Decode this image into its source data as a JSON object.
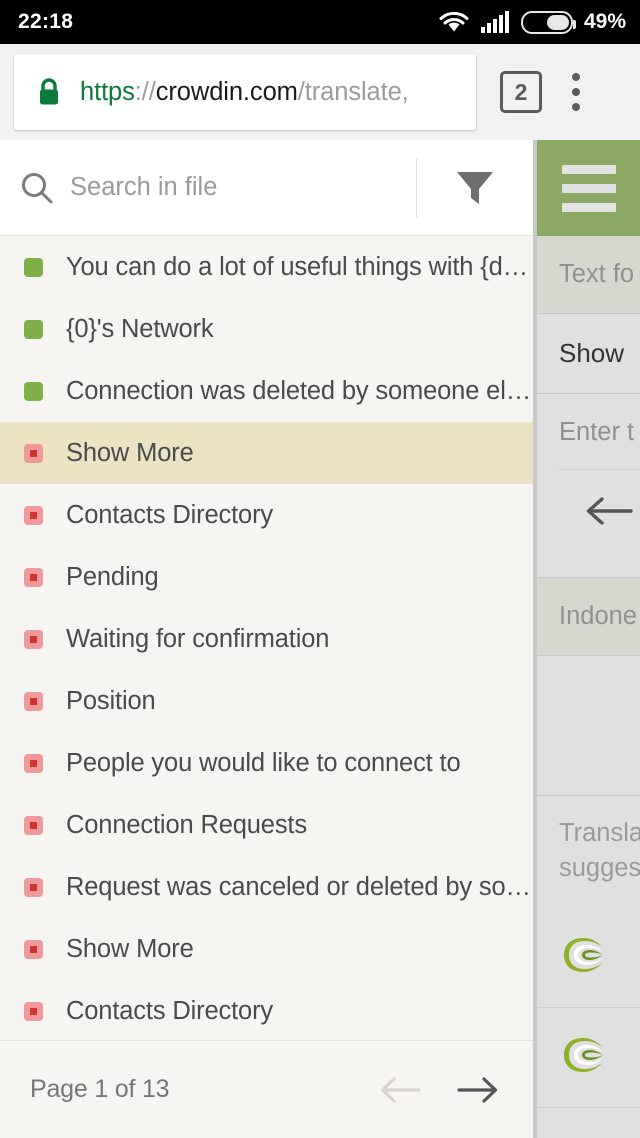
{
  "status_bar": {
    "time": "22:18",
    "battery_percent": "49%",
    "battery_level": 49,
    "icons": [
      "wifi-icon",
      "cellular-signal-icon",
      "battery-icon"
    ]
  },
  "browser": {
    "url_scheme": "https",
    "url_separator": "://",
    "url_host": "crowdin.com",
    "url_path": "/translate,",
    "lock_icon": "lock-icon",
    "tab_count": "2",
    "menu_icon": "kebab-menu-icon"
  },
  "search": {
    "placeholder": "Search in file",
    "value": "",
    "search_icon": "search-icon",
    "filter_icon": "filter-funnel-icon"
  },
  "sidebar_toggle": {
    "icon": "hamburger-menu-icon",
    "color": "#8ba864"
  },
  "colors": {
    "translated": "#7eb04a",
    "untranslated": "#ef9a9a",
    "untranslated_dot": "#d0342c",
    "selected_row": "#ece3c4",
    "accent_green": "#8ba864",
    "list_bg": "#f6f5f1"
  },
  "string_list": {
    "items": [
      {
        "label": "You can do a lot of useful things with {d…",
        "status": "translated",
        "selected": false
      },
      {
        "label": "{0}'s Network",
        "status": "translated",
        "selected": false
      },
      {
        "label": "Connection was deleted by someone el…",
        "status": "translated",
        "selected": false
      },
      {
        "label": "Show More",
        "status": "untranslated",
        "selected": true
      },
      {
        "label": "Contacts Directory",
        "status": "untranslated",
        "selected": false
      },
      {
        "label": "Pending",
        "status": "untranslated",
        "selected": false
      },
      {
        "label": "Waiting for confirmation",
        "status": "untranslated",
        "selected": false
      },
      {
        "label": "Position",
        "status": "untranslated",
        "selected": false
      },
      {
        "label": "People you would like to connect to",
        "status": "untranslated",
        "selected": false
      },
      {
        "label": "Connection Requests",
        "status": "untranslated",
        "selected": false
      },
      {
        "label": "Request was canceled or deleted by so…",
        "status": "untranslated",
        "selected": false
      },
      {
        "label": "Show More",
        "status": "untranslated",
        "selected": false
      },
      {
        "label": "Contacts Directory",
        "status": "untranslated",
        "selected": false
      }
    ]
  },
  "pagination": {
    "text": "Page 1 of 13",
    "current_page": 1,
    "total_pages": 13,
    "prev_icon": "arrow-left-icon",
    "next_icon": "arrow-right-icon",
    "prev_enabled": false,
    "next_enabled": true
  },
  "editor_panel": {
    "source_header": "Text fo",
    "source_text": "Show",
    "translation_placeholder": "Enter t",
    "back_icon": "arrow-left-icon",
    "language": "Indone",
    "suggestions_line1": "Transla",
    "suggestions_line2": "sugges",
    "tm_items": [
      "crowdin-logo-icon",
      "crowdin-logo-icon"
    ]
  }
}
